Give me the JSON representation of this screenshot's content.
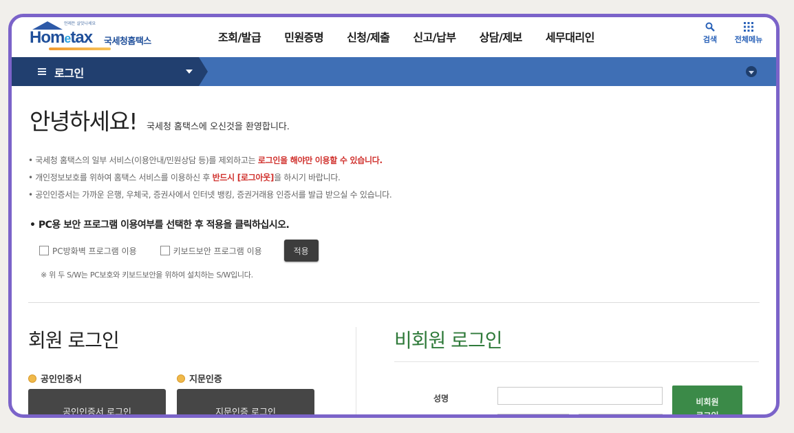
{
  "logo": {
    "slogan": "언제든 살맛나세요",
    "name_prefix": "Hom",
    "name_e": "e",
    "name_suffix": "tax",
    "subtitle": "국세청홈택스"
  },
  "gnb": [
    "조회/발급",
    "민원증명",
    "신청/제출",
    "신고/납부",
    "상담/제보",
    "세무대리인"
  ],
  "tools": {
    "search": "검색",
    "menu": "전체메뉴"
  },
  "navbar": {
    "title": "로그인"
  },
  "greeting": {
    "title": "안녕하세요!",
    "welcome": "국세청 홈택스에 오신것을 환영합니다."
  },
  "notes": {
    "n1_prefix": "• 국세청 홈택스의 일부 서비스(이용안내/민원상담 등)를 제외하고는 ",
    "n1_highlight": "로그인을 해야만 이용할 수 있습니다.",
    "n2_prefix": "• 개인정보보호를 위하여 홈택스 서비스를 이용하신 후 ",
    "n2_highlight": "반드시 [로그아웃]",
    "n2_suffix": "을 하시기 바랍니다.",
    "n3": "• 공인인증서는 가까운 은행, 우체국, 증권사에서 인터넷 뱅킹, 증권거래용 인증서를 발급 받으실 수 있습니다."
  },
  "security": {
    "title": "• PC용 보안 프로그램 이용여부를 선택한 후 적용을 클릭하십시오.",
    "firewall": "PC방화벽 프로그램 이용",
    "keyboard": "키보드보안 프로그램 이용",
    "apply": "적용",
    "note": "※ 위 두 S/W는 PC보호와 키보드보안을 위하여 설치하는 S/W입니다."
  },
  "member": {
    "title": "회원 로그인",
    "cert_label": "공인인증서",
    "finger_label": "지문인증",
    "cert_button": "공인인증서 로그인",
    "finger_button": "지문인증 로그인"
  },
  "nonmember": {
    "title": "비회원 로그인",
    "name_label": "성명",
    "button_line1": "비회원",
    "button_line2": "로그인"
  }
}
